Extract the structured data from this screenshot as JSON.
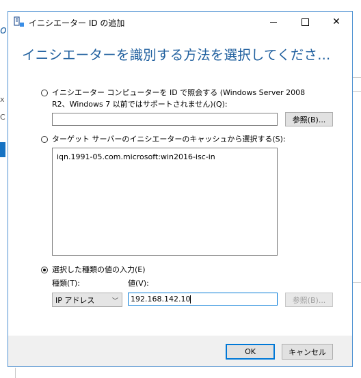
{
  "window": {
    "title": "イニシエーター ID の追加",
    "heading": "イニシエーターを識別する方法を選択してくださ..."
  },
  "options": {
    "computer_id_line1": "イニシエーター コンピューターを ID で照会する (Windows Server 2008",
    "computer_id_line2": "R2、Windows 7 以前ではサポートされません)(Q):",
    "computer_id_value": "",
    "browse_label": "参照(B)...",
    "cache_label": "ターゲット サーバーのイニシエーターのキャッシュから選択する(S):",
    "cache_items": [
      "iqn.1991-05.com.microsoft:win2016-isc-in"
    ],
    "enter_value_label": "選択した種類の値の入力(E)",
    "type_label": "種類(T):",
    "value_label": "値(V):",
    "type_selected": "IP アドレス",
    "value_input": "192.168.142.10",
    "browse2_label": "参照(B)...",
    "selected_option": "enter_value"
  },
  "buttons": {
    "ok": "OK",
    "cancel": "キャンセル"
  },
  "colors": {
    "accent": "#1f5f9e",
    "focus": "#0078d7"
  }
}
